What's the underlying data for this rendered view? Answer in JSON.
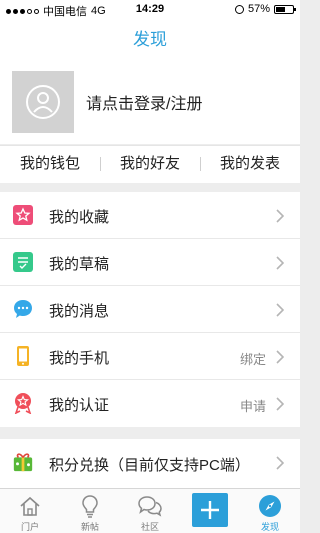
{
  "status_bar": {
    "carrier": "中国电信",
    "network": "4G",
    "time": "14:29",
    "battery_text": "57%",
    "battery_level": 0.57
  },
  "nav": {
    "title": "发现"
  },
  "profile": {
    "login_text": "请点击登录/注册",
    "avatar_icon": "user-icon"
  },
  "quick_links": [
    {
      "label": "我的钱包"
    },
    {
      "label": "我的好友"
    },
    {
      "label": "我的发表"
    }
  ],
  "menu": [
    {
      "label": "我的收藏",
      "icon": "star-icon",
      "color": "#ee4d78",
      "extra": ""
    },
    {
      "label": "我的草稿",
      "icon": "draft-icon",
      "color": "#35c98b",
      "extra": ""
    },
    {
      "label": "我的消息",
      "icon": "message-icon",
      "color": "#35a8e8",
      "extra": ""
    },
    {
      "label": "我的手机",
      "icon": "phone-icon",
      "color": "#f5b325",
      "extra": "绑定"
    },
    {
      "label": "我的认证",
      "icon": "certification-icon",
      "color": "#f04f5a",
      "extra": "申请"
    }
  ],
  "menu2": [
    {
      "label": "积分兑换（目前仅支持PC端）",
      "icon": "gift-icon",
      "color": "#58b838",
      "extra": ""
    }
  ],
  "tabs": [
    {
      "label": "门户",
      "icon": "home-icon"
    },
    {
      "label": "新帖",
      "icon": "lightbulb-icon"
    },
    {
      "label": "社区",
      "icon": "chat-icon"
    },
    {
      "label": "",
      "icon": "plus-icon"
    },
    {
      "label": "发现",
      "icon": "compass-icon",
      "active": true
    }
  ],
  "colors": {
    "accent": "#2c9fd9"
  }
}
